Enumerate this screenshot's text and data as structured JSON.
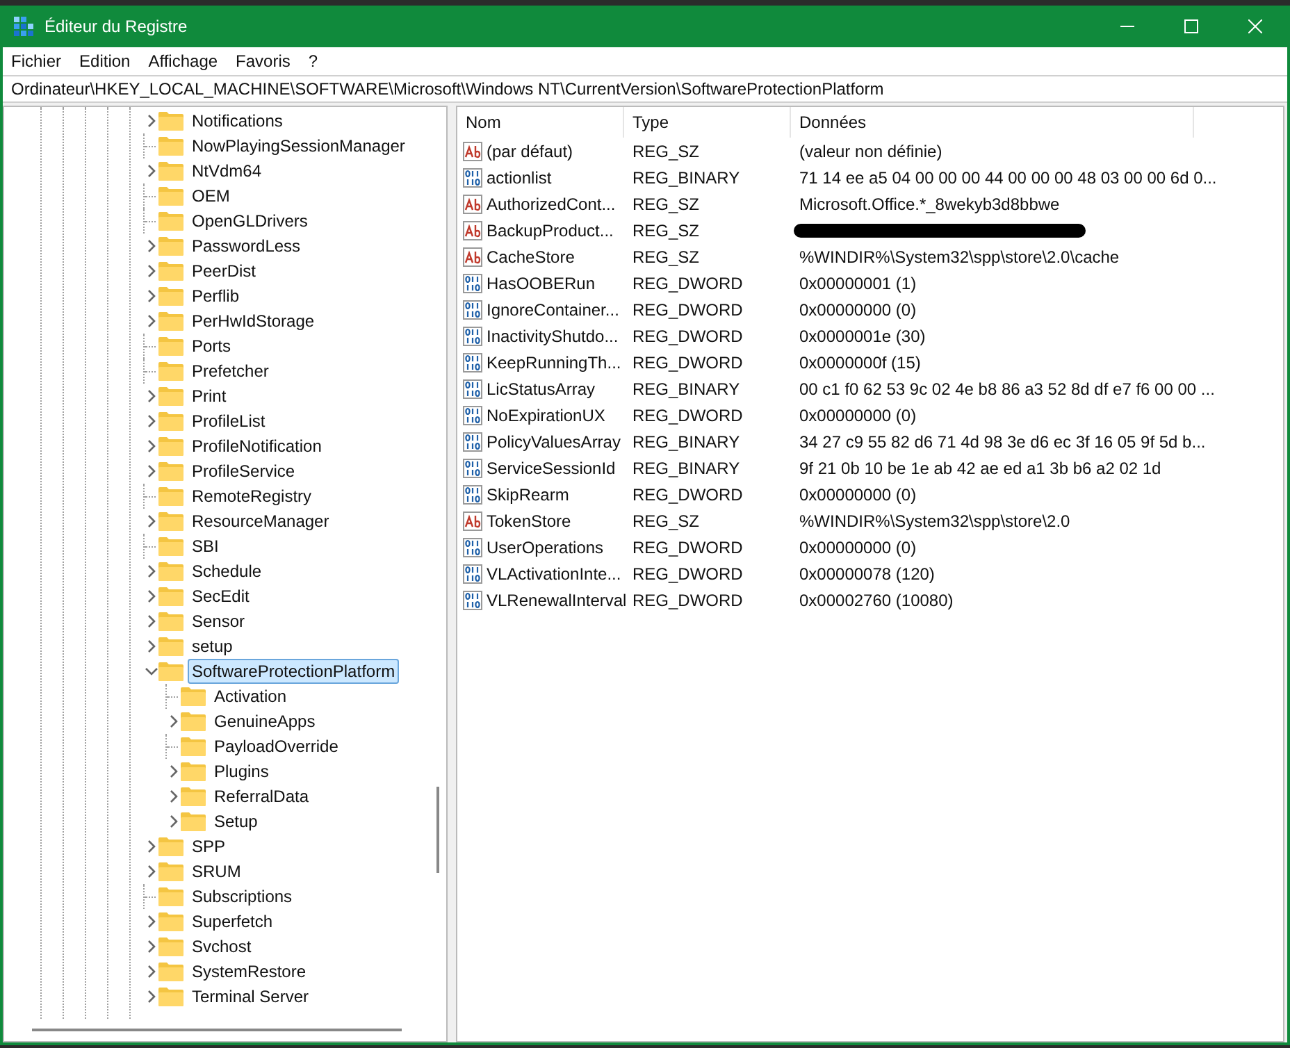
{
  "window": {
    "title": "Éditeur du Registre"
  },
  "menu": [
    "Fichier",
    "Edition",
    "Affichage",
    "Favoris",
    "?"
  ],
  "address": "Ordinateur\\HKEY_LOCAL_MACHINE\\SOFTWARE\\Microsoft\\Windows NT\\CurrentVersion\\SoftwareProtectionPlatform",
  "tree": [
    {
      "label": "Notifications",
      "expandable": true,
      "expanded": false,
      "selected": false
    },
    {
      "label": "NowPlayingSessionManager",
      "expandable": false,
      "selected": false
    },
    {
      "label": "NtVdm64",
      "expandable": true,
      "expanded": false,
      "selected": false
    },
    {
      "label": "OEM",
      "expandable": false,
      "selected": false
    },
    {
      "label": "OpenGLDrivers",
      "expandable": false,
      "selected": false
    },
    {
      "label": "PasswordLess",
      "expandable": true,
      "expanded": false,
      "selected": false
    },
    {
      "label": "PeerDist",
      "expandable": true,
      "expanded": false,
      "selected": false
    },
    {
      "label": "Perflib",
      "expandable": true,
      "expanded": false,
      "selected": false
    },
    {
      "label": "PerHwIdStorage",
      "expandable": true,
      "expanded": false,
      "selected": false
    },
    {
      "label": "Ports",
      "expandable": false,
      "selected": false
    },
    {
      "label": "Prefetcher",
      "expandable": false,
      "selected": false
    },
    {
      "label": "Print",
      "expandable": true,
      "expanded": false,
      "selected": false
    },
    {
      "label": "ProfileList",
      "expandable": true,
      "expanded": false,
      "selected": false
    },
    {
      "label": "ProfileNotification",
      "expandable": true,
      "expanded": false,
      "selected": false
    },
    {
      "label": "ProfileService",
      "expandable": true,
      "expanded": false,
      "selected": false
    },
    {
      "label": "RemoteRegistry",
      "expandable": false,
      "selected": false
    },
    {
      "label": "ResourceManager",
      "expandable": true,
      "expanded": false,
      "selected": false
    },
    {
      "label": "SBI",
      "expandable": false,
      "selected": false
    },
    {
      "label": "Schedule",
      "expandable": true,
      "expanded": false,
      "selected": false
    },
    {
      "label": "SecEdit",
      "expandable": true,
      "expanded": false,
      "selected": false
    },
    {
      "label": "Sensor",
      "expandable": true,
      "expanded": false,
      "selected": false
    },
    {
      "label": "setup",
      "expandable": true,
      "expanded": false,
      "selected": false
    },
    {
      "label": "SoftwareProtectionPlatform",
      "expandable": true,
      "expanded": true,
      "selected": true,
      "children": [
        {
          "label": "Activation",
          "expandable": false,
          "selected": false
        },
        {
          "label": "GenuineApps",
          "expandable": true,
          "expanded": false,
          "selected": false
        },
        {
          "label": "PayloadOverride",
          "expandable": false,
          "selected": false
        },
        {
          "label": "Plugins",
          "expandable": true,
          "expanded": false,
          "selected": false
        },
        {
          "label": "ReferralData",
          "expandable": true,
          "expanded": false,
          "selected": false
        },
        {
          "label": "Setup",
          "expandable": true,
          "expanded": false,
          "selected": false
        }
      ]
    },
    {
      "label": "SPP",
      "expandable": true,
      "expanded": false,
      "selected": false
    },
    {
      "label": "SRUM",
      "expandable": true,
      "expanded": false,
      "selected": false
    },
    {
      "label": "Subscriptions",
      "expandable": false,
      "selected": false
    },
    {
      "label": "Superfetch",
      "expandable": true,
      "expanded": false,
      "selected": false
    },
    {
      "label": "Svchost",
      "expandable": true,
      "expanded": false,
      "selected": false
    },
    {
      "label": "SystemRestore",
      "expandable": true,
      "expanded": false,
      "selected": false
    },
    {
      "label": "Terminal Server",
      "expandable": true,
      "expanded": false,
      "selected": false
    }
  ],
  "table": {
    "columns": [
      "Nom",
      "Type",
      "Données"
    ],
    "rows": [
      {
        "kind": "string",
        "name": "(par défaut)",
        "type": "REG_SZ",
        "data": "(valeur non définie)",
        "redacted": false
      },
      {
        "kind": "binary",
        "name": "actionlist",
        "type": "REG_BINARY",
        "data": "71 14 ee a5 04 00 00 00 44 00 00 00 48 03 00 00 6d 0...",
        "redacted": false
      },
      {
        "kind": "string",
        "name": "AuthorizedCont...",
        "type": "REG_SZ",
        "data": "Microsoft.Office.*_8wekyb3d8bbwe",
        "redacted": false
      },
      {
        "kind": "string",
        "name": "BackupProduct...",
        "type": "REG_SZ",
        "redacted": true
      },
      {
        "kind": "string",
        "name": "CacheStore",
        "type": "REG_SZ",
        "data": "%WINDIR%\\System32\\spp\\store\\2.0\\cache",
        "redacted": false
      },
      {
        "kind": "binary",
        "name": "HasOOBERun",
        "type": "REG_DWORD",
        "data": "0x00000001 (1)",
        "redacted": false
      },
      {
        "kind": "binary",
        "name": "IgnoreContainer...",
        "type": "REG_DWORD",
        "data": "0x00000000 (0)",
        "redacted": false
      },
      {
        "kind": "binary",
        "name": "InactivityShutdo...",
        "type": "REG_DWORD",
        "data": "0x0000001e (30)",
        "redacted": false
      },
      {
        "kind": "binary",
        "name": "KeepRunningTh...",
        "type": "REG_DWORD",
        "data": "0x0000000f (15)",
        "redacted": false
      },
      {
        "kind": "binary",
        "name": "LicStatusArray",
        "type": "REG_BINARY",
        "data": "00 c1 f0 62 53 9c 02 4e b8 86 a3 52 8d df e7 f6 00 00 ...",
        "redacted": false
      },
      {
        "kind": "binary",
        "name": "NoExpirationUX",
        "type": "REG_DWORD",
        "data": "0x00000000 (0)",
        "redacted": false
      },
      {
        "kind": "binary",
        "name": "PolicyValuesArray",
        "type": "REG_BINARY",
        "data": "34 27 c9 55 82 d6 71 4d 98 3e d6 ec 3f 16 05 9f 5d b...",
        "redacted": false
      },
      {
        "kind": "binary",
        "name": "ServiceSessionId",
        "type": "REG_BINARY",
        "data": "9f 21 0b 10 be 1e ab 42 ae ed a1 3b b6 a2 02 1d",
        "redacted": false
      },
      {
        "kind": "binary",
        "name": "SkipRearm",
        "type": "REG_DWORD",
        "data": "0x00000000 (0)",
        "redacted": false
      },
      {
        "kind": "string",
        "name": "TokenStore",
        "type": "REG_SZ",
        "data": "%WINDIR%\\System32\\spp\\store\\2.0",
        "redacted": false
      },
      {
        "kind": "binary",
        "name": "UserOperations",
        "type": "REG_DWORD",
        "data": "0x00000000 (0)",
        "redacted": false
      },
      {
        "kind": "binary",
        "name": "VLActivationInte...",
        "type": "REG_DWORD",
        "data": "0x00000078 (120)",
        "redacted": false
      },
      {
        "kind": "binary",
        "name": "VLRenewalInterval",
        "type": "REG_DWORD",
        "data": "0x00002760 (10080)",
        "redacted": false
      }
    ]
  }
}
